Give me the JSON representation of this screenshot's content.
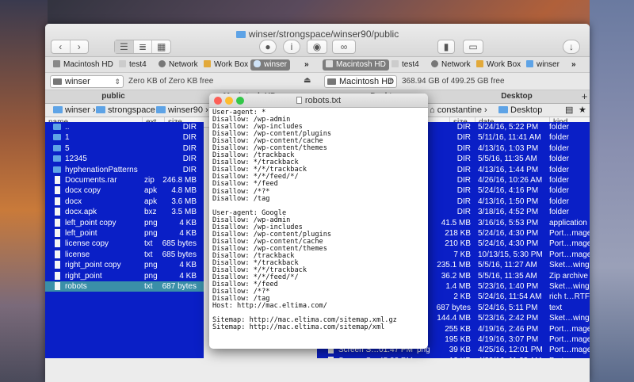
{
  "window": {
    "title": "winser/strongspace/winser90/public"
  },
  "favorites_left": [
    {
      "label": "Macintosh HD",
      "icon": "hard-drive-icon",
      "selected": false
    },
    {
      "label": "test4",
      "icon": "file-icon",
      "selected": false
    },
    {
      "label": "Network",
      "icon": "globe-icon",
      "selected": false
    },
    {
      "label": "Work Box",
      "icon": "box-icon",
      "selected": false
    },
    {
      "label": "winser",
      "icon": "cloud-icon",
      "selected": true
    }
  ],
  "favorites_right": [
    {
      "label": "Macintosh HD",
      "icon": "hard-drive-icon",
      "selected": true
    },
    {
      "label": "test4",
      "icon": "file-icon",
      "selected": false
    },
    {
      "label": "Network",
      "icon": "globe-icon",
      "selected": false
    },
    {
      "label": "Work Box",
      "icon": "box-icon",
      "selected": false
    },
    {
      "label": "winser",
      "icon": "folder-icon",
      "selected": false
    }
  ],
  "more_label": "»",
  "left_drive": {
    "name": "winser",
    "free": "Zero KB of Zero KB free"
  },
  "right_drive": {
    "name": "Macintosh HD",
    "free": "368.94 GB of 499.25 GB free"
  },
  "tabs": {
    "left": "public",
    "left2": "Macintosh HD",
    "right2": "Desktop",
    "right": "Desktop",
    "add": "+"
  },
  "left_path": [
    "winser",
    "strongspace",
    "winser90",
    "public"
  ],
  "right_path": [
    "constantine",
    "Desktop"
  ],
  "left_columns": {
    "name": "name",
    "ext": "ext",
    "size": "size"
  },
  "right_columns": {
    "size": "size",
    "date": "date",
    "kind": "kind"
  },
  "left_rows": [
    {
      "name": "..",
      "ext": "",
      "size": "DIR",
      "type": "folder"
    },
    {
      "name": "1",
      "ext": "",
      "size": "DIR",
      "type": "folder"
    },
    {
      "name": "5",
      "ext": "",
      "size": "DIR",
      "type": "folder"
    },
    {
      "name": "12345",
      "ext": "",
      "size": "DIR",
      "type": "folder"
    },
    {
      "name": "hyphenationPatterns",
      "ext": "",
      "size": "DIR",
      "type": "folder"
    },
    {
      "name": "Documents.rar",
      "ext": "zip",
      "size": "246.8 MB",
      "type": "file"
    },
    {
      "name": "docx copy",
      "ext": "apk",
      "size": "4.8 MB",
      "type": "file"
    },
    {
      "name": "docx",
      "ext": "apk",
      "size": "3.6 MB",
      "type": "file"
    },
    {
      "name": "docx.apk",
      "ext": "bxz",
      "size": "3.5 MB",
      "type": "file"
    },
    {
      "name": "left_point copy",
      "ext": "png",
      "size": "4 KB",
      "type": "file"
    },
    {
      "name": "left_point",
      "ext": "png",
      "size": "4 KB",
      "type": "file"
    },
    {
      "name": "license copy",
      "ext": "txt",
      "size": "685 bytes",
      "type": "file"
    },
    {
      "name": "license",
      "ext": "txt",
      "size": "685 bytes",
      "type": "file"
    },
    {
      "name": "right_point copy",
      "ext": "png",
      "size": "4 KB",
      "type": "file"
    },
    {
      "name": "right_point",
      "ext": "png",
      "size": "4 KB",
      "type": "file"
    },
    {
      "name": "robots",
      "ext": "txt",
      "size": "687 bytes",
      "type": "file",
      "selected": true
    }
  ],
  "right_rows": [
    {
      "size": "DIR",
      "date": "5/24/16, 5:22 PM",
      "kind": "folder"
    },
    {
      "size": "DIR",
      "date": "5/11/16, 11:41 AM",
      "kind": "folder"
    },
    {
      "size": "DIR",
      "date": "4/13/16, 1:03 PM",
      "kind": "folder"
    },
    {
      "size": "DIR",
      "date": "5/5/16, 11:35 AM",
      "kind": "folder"
    },
    {
      "size": "DIR",
      "date": "4/13/16, 1:44 PM",
      "kind": "folder"
    },
    {
      "size": "DIR",
      "date": "4/26/16, 10:26 AM",
      "kind": "folder"
    },
    {
      "size": "DIR",
      "date": "5/24/16, 4:16 PM",
      "kind": "folder"
    },
    {
      "size": "DIR",
      "date": "4/13/16, 1:50 PM",
      "kind": "folder"
    },
    {
      "size": "DIR",
      "date": "3/18/16, 4:52 PM",
      "kind": "folder"
    },
    {
      "size": "41.5 MB",
      "date": "3/16/16, 5:53 PM",
      "kind": "application"
    },
    {
      "size": "218 KB",
      "date": "5/24/16, 4:30 PM",
      "kind": "Port…mage"
    },
    {
      "size": "210 KB",
      "date": "5/24/16, 4:30 PM",
      "kind": "Port…mage"
    },
    {
      "size": "7 KB",
      "date": "10/13/15, 5:30 PM",
      "kind": "Port…mage"
    },
    {
      "size": "235.1 MB",
      "date": "5/5/16, 11:27 AM",
      "kind": "Sket…wing"
    },
    {
      "size": "36.2 MB",
      "date": "5/5/16, 11:35 AM",
      "kind": "Zip archive"
    },
    {
      "size": "1.4 MB",
      "date": "5/23/16, 1:40 PM",
      "kind": "Sket…wing"
    },
    {
      "size": "2 KB",
      "date": "5/24/16, 11:54 AM",
      "kind": "rich t…RTF)"
    },
    {
      "size": "687 bytes",
      "date": "5/24/16, 5:11 PM",
      "kind": "text"
    },
    {
      "size": "144.4 MB",
      "date": "5/23/16, 2:42 PM",
      "kind": "Sket…wing"
    },
    {
      "size": "255 KB",
      "date": "4/19/16, 2:46 PM",
      "kind": "Port…mage"
    },
    {
      "size": "195 KB",
      "date": "4/19/16, 3:07 PM",
      "kind": "Port…mage"
    },
    {
      "size": "39 KB",
      "date": "4/25/16, 12:01 PM",
      "kind": "Port…mage"
    },
    {
      "size": "12 KB",
      "date": "4/29/16, 11:23 AM",
      "kind": "Port…mage"
    },
    {
      "size": "43 KB",
      "date": "4/29/16, 11:13 AM",
      "kind": "Port…mage"
    }
  ],
  "right_partial_rows": [
    {
      "name": "Screen S…01.47 PM",
      "ext": "png"
    },
    {
      "name": "Screen S…45.33 PM",
      "ext": "png"
    },
    {
      "name": "Screen S…13.48 AM",
      "ext": "png"
    }
  ],
  "quicklook": {
    "title": "robots.txt",
    "content": "User-agent: *\nDisallow: /wp-admin\nDisallow: /wp-includes\nDisallow: /wp-content/plugins\nDisallow: /wp-content/cache\nDisallow: /wp-content/themes\nDisallow: /trackback\nDisallow: */trackback\nDisallow: */*/trackback\nDisallow: */*/feed/*/\nDisallow: */feed\nDisallow: /*?*\nDisallow: /tag\n\nUser-agent: Google\nDisallow: /wp-admin\nDisallow: /wp-includes\nDisallow: /wp-content/plugins\nDisallow: /wp-content/cache\nDisallow: /wp-content/themes\nDisallow: /trackback\nDisallow: */trackback\nDisallow: */*/trackback\nDisallow: */*/feed/*/\nDisallow: */feed\nDisallow: /*?*\nDisallow: /tag\nHost: http://mac.eltima.com/\n\nSitemap: http://mac.eltima.com/sitemap.xml.gz\nSitemap: http://mac.eltima.com/sitemap/xml"
  }
}
